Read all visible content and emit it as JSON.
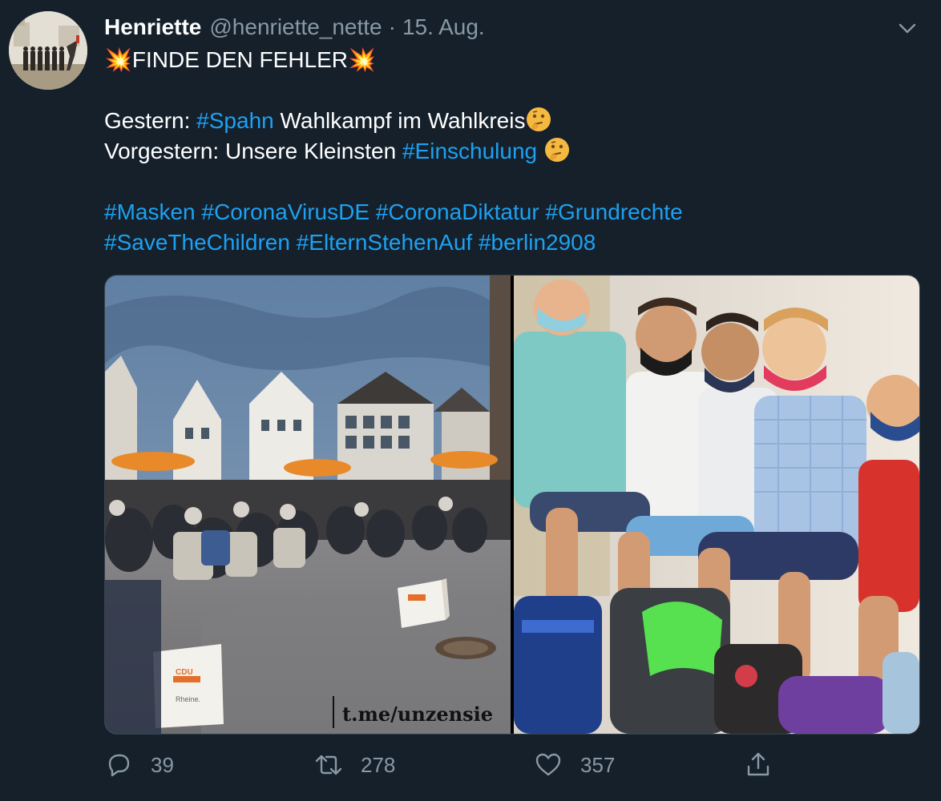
{
  "tweet": {
    "author": {
      "display_name": "Henriette",
      "handle": "@henriette_nette",
      "separator": "·",
      "date": "15. Aug."
    },
    "text": {
      "line1": {
        "emoji_left": "💥",
        "title": "FINDE DEN FEHLER",
        "emoji_right": "💥"
      },
      "line2": {
        "prefix": "Gestern: ",
        "hashtag": "#Spahn",
        "suffix": " Wahlkampf im Wahlkreis"
      },
      "line3": {
        "prefix": "Vorgestern: Unsere Kleinsten ",
        "hashtag": "#Einschulung"
      },
      "hashtags_line1": [
        "#Masken",
        "#CoronaVirusDE",
        "#CoronaDiktatur",
        "#Grundrechte"
      ],
      "hashtags_line2": [
        "#SaveTheChildren",
        "#ElternStehenAuf",
        "#berlin2908"
      ]
    },
    "media": {
      "left_photo": {
        "box_label_1": "CDU",
        "box_label_2": "Rheine.",
        "watermark": "t.me/unzensie"
      }
    },
    "actions": {
      "replies": "39",
      "retweets": "278",
      "likes": "357"
    }
  },
  "colors": {
    "background": "#15202b",
    "text": "#ffffff",
    "secondary_text": "#8899a6",
    "hashtag": "#1da1f2",
    "border": "#38444d"
  },
  "icons": {
    "more": "chevron-down-icon",
    "reply": "reply-icon",
    "retweet": "retweet-icon",
    "like": "heart-icon",
    "share": "share-icon",
    "emphasis": "collision-emoji",
    "thinking": "thinking-face-emoji"
  }
}
